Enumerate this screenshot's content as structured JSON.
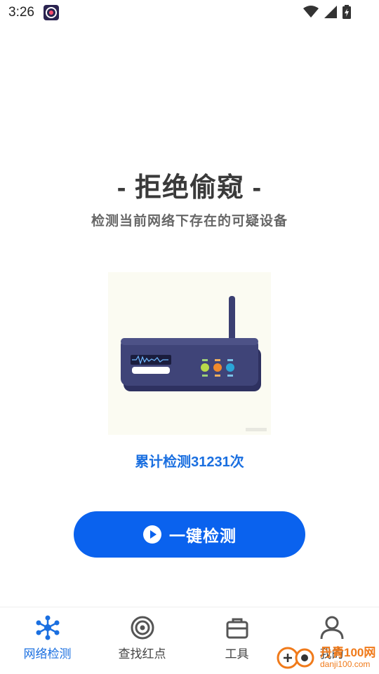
{
  "status": {
    "time": "3:26"
  },
  "hero": {
    "title": "- 拒绝偷窥 -",
    "subtitle": "检测当前网络下存在的可疑设备"
  },
  "counter": {
    "text": "累计检测31231次"
  },
  "scan_button": {
    "label": "一键检测"
  },
  "nav": {
    "items": [
      {
        "label": "网络检测",
        "icon": "network-icon",
        "active": true
      },
      {
        "label": "查找红点",
        "icon": "target-icon",
        "active": false
      },
      {
        "label": "工具",
        "icon": "briefcase-icon",
        "active": false
      },
      {
        "label": "我的",
        "icon": "user-icon",
        "active": false
      }
    ]
  },
  "watermark": {
    "title": "丹青100网",
    "url": "danji100.com"
  },
  "colors": {
    "accent": "#0a62ee",
    "accent_text": "#1a6fe0",
    "device": "#3b3f72"
  }
}
